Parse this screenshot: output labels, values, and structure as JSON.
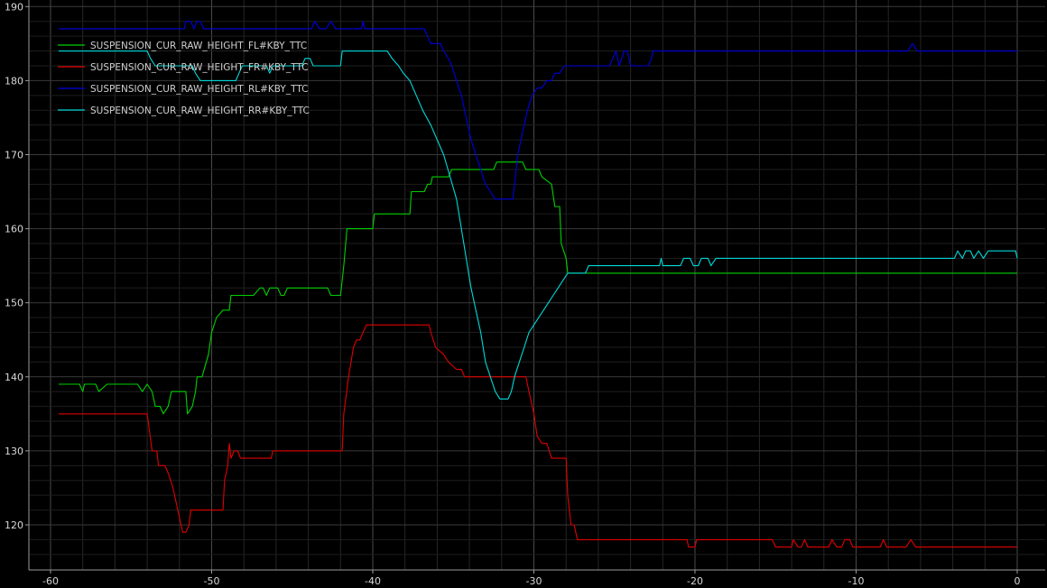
{
  "chart_data": {
    "type": "line",
    "title": "",
    "xlabel": "",
    "ylabel": "",
    "xlim": [
      -60,
      0
    ],
    "ylim": [
      115,
      190
    ],
    "x_ticks": [
      -60,
      -50,
      -40,
      -30,
      -20,
      -10,
      0
    ],
    "y_ticks": [
      120,
      130,
      140,
      150,
      160,
      170,
      180,
      190
    ],
    "grid": true,
    "legend_position": "top-left",
    "series": [
      {
        "name": "SUSPENSION_CUR_RAW_HEIGHT_FL#KBY_TTC",
        "color": "#00d000",
        "points": [
          [
            -59.5,
            139
          ],
          [
            -58.2,
            139
          ],
          [
            -58.0,
            138
          ],
          [
            -57.9,
            139
          ],
          [
            -57.2,
            139
          ],
          [
            -57.0,
            138
          ],
          [
            -56.5,
            139
          ],
          [
            -54.6,
            139
          ],
          [
            -54.3,
            138
          ],
          [
            -54.0,
            139
          ],
          [
            -53.7,
            138
          ],
          [
            -53.5,
            136
          ],
          [
            -53.2,
            136
          ],
          [
            -53.0,
            135
          ],
          [
            -52.7,
            136
          ],
          [
            -52.5,
            138
          ],
          [
            -51.6,
            138
          ],
          [
            -51.5,
            135
          ],
          [
            -51.2,
            136
          ],
          [
            -51.0,
            138
          ],
          [
            -50.9,
            140
          ],
          [
            -50.6,
            140
          ],
          [
            -50.2,
            143
          ],
          [
            -50.0,
            146
          ],
          [
            -49.7,
            148
          ],
          [
            -49.3,
            149
          ],
          [
            -48.9,
            149
          ],
          [
            -48.8,
            151
          ],
          [
            -47.4,
            151
          ],
          [
            -47.0,
            152
          ],
          [
            -46.8,
            152
          ],
          [
            -46.6,
            151
          ],
          [
            -46.4,
            152
          ],
          [
            -45.9,
            152
          ],
          [
            -45.7,
            151
          ],
          [
            -45.5,
            151
          ],
          [
            -45.3,
            152
          ],
          [
            -42.8,
            152
          ],
          [
            -42.6,
            151
          ],
          [
            -42.0,
            151
          ],
          [
            -41.8,
            155
          ],
          [
            -41.6,
            160
          ],
          [
            -40.0,
            160
          ],
          [
            -39.9,
            162
          ],
          [
            -37.7,
            162
          ],
          [
            -37.6,
            165
          ],
          [
            -36.8,
            165
          ],
          [
            -36.6,
            166
          ],
          [
            -36.4,
            166
          ],
          [
            -36.3,
            167
          ],
          [
            -35.3,
            167
          ],
          [
            -35.1,
            168
          ],
          [
            -34.3,
            168
          ],
          [
            -34.1,
            168
          ],
          [
            -32.5,
            168
          ],
          [
            -32.3,
            169
          ],
          [
            -30.7,
            169
          ],
          [
            -30.5,
            168
          ],
          [
            -29.7,
            168
          ],
          [
            -29.5,
            167
          ],
          [
            -28.9,
            166
          ],
          [
            -28.7,
            163
          ],
          [
            -28.4,
            163
          ],
          [
            -28.3,
            158
          ],
          [
            -28.0,
            156
          ],
          [
            -27.9,
            154
          ],
          [
            0,
            154
          ]
        ]
      },
      {
        "name": "SUSPENSION_CUR_RAW_HEIGHT_FR#KBY_TTC",
        "color": "#e00000",
        "points": [
          [
            -59.5,
            135
          ],
          [
            -54.0,
            135
          ],
          [
            -53.7,
            130
          ],
          [
            -53.4,
            130
          ],
          [
            -53.3,
            128
          ],
          [
            -52.9,
            128
          ],
          [
            -52.7,
            127
          ],
          [
            -52.4,
            125
          ],
          [
            -52.1,
            122
          ],
          [
            -51.8,
            119
          ],
          [
            -51.6,
            119
          ],
          [
            -51.4,
            120
          ],
          [
            -51.3,
            122
          ],
          [
            -49.3,
            122
          ],
          [
            -49.2,
            126
          ],
          [
            -49.0,
            128
          ],
          [
            -48.9,
            131
          ],
          [
            -48.8,
            129
          ],
          [
            -48.6,
            130
          ],
          [
            -48.4,
            130
          ],
          [
            -48.2,
            129
          ],
          [
            -46.3,
            129
          ],
          [
            -46.2,
            130
          ],
          [
            -41.9,
            130
          ],
          [
            -41.8,
            135
          ],
          [
            -41.5,
            140
          ],
          [
            -41.2,
            144
          ],
          [
            -41.0,
            145
          ],
          [
            -40.8,
            145
          ],
          [
            -40.6,
            146
          ],
          [
            -40.4,
            147
          ],
          [
            -36.5,
            147
          ],
          [
            -36.4,
            146
          ],
          [
            -36.1,
            144
          ],
          [
            -35.6,
            143
          ],
          [
            -35.3,
            142
          ],
          [
            -34.8,
            141
          ],
          [
            -34.5,
            141
          ],
          [
            -34.3,
            140
          ],
          [
            -30.5,
            140
          ],
          [
            -30.3,
            138
          ],
          [
            -30.0,
            135
          ],
          [
            -29.8,
            132
          ],
          [
            -29.5,
            131
          ],
          [
            -29.2,
            131
          ],
          [
            -28.9,
            129
          ],
          [
            -28.0,
            129
          ],
          [
            -27.9,
            124
          ],
          [
            -27.7,
            120
          ],
          [
            -27.5,
            120
          ],
          [
            -27.3,
            118
          ],
          [
            -20.5,
            118
          ],
          [
            -20.4,
            117
          ],
          [
            -20.0,
            117
          ],
          [
            -19.9,
            118
          ],
          [
            -15.2,
            118
          ],
          [
            -15.0,
            117
          ],
          [
            -14.0,
            117
          ],
          [
            -13.9,
            118
          ],
          [
            -13.6,
            117
          ],
          [
            -13.4,
            117
          ],
          [
            -13.2,
            118
          ],
          [
            -13.0,
            117
          ],
          [
            -11.7,
            117
          ],
          [
            -11.5,
            118
          ],
          [
            -11.2,
            117
          ],
          [
            -10.9,
            117
          ],
          [
            -10.7,
            118
          ],
          [
            -10.4,
            118
          ],
          [
            -10.2,
            117
          ],
          [
            -8.5,
            117
          ],
          [
            -8.3,
            118
          ],
          [
            -8.1,
            117
          ],
          [
            -6.9,
            117
          ],
          [
            -6.6,
            118
          ],
          [
            -6.3,
            117
          ],
          [
            0,
            117
          ]
        ]
      },
      {
        "name": "SUSPENSION_CUR_RAW_HEIGHT_RL#KBY_TTC",
        "color": "#0000e0",
        "points": [
          [
            -59.5,
            187
          ],
          [
            -51.7,
            187
          ],
          [
            -51.6,
            188
          ],
          [
            -51.3,
            188
          ],
          [
            -51.1,
            187
          ],
          [
            -50.9,
            188
          ],
          [
            -50.7,
            188
          ],
          [
            -50.5,
            187
          ],
          [
            -43.8,
            187
          ],
          [
            -43.6,
            188
          ],
          [
            -43.3,
            187
          ],
          [
            -42.9,
            187
          ],
          [
            -42.6,
            188
          ],
          [
            -42.3,
            187
          ],
          [
            -40.7,
            187
          ],
          [
            -40.6,
            188
          ],
          [
            -40.5,
            187
          ],
          [
            -36.8,
            187
          ],
          [
            -36.6,
            186
          ],
          [
            -36.4,
            185
          ],
          [
            -35.8,
            185
          ],
          [
            -35.6,
            184
          ],
          [
            -35.3,
            183
          ],
          [
            -35.1,
            182
          ],
          [
            -34.8,
            180
          ],
          [
            -34.5,
            178
          ],
          [
            -34.2,
            175
          ],
          [
            -33.9,
            172
          ],
          [
            -33.6,
            170
          ],
          [
            -33.3,
            168
          ],
          [
            -33.0,
            166
          ],
          [
            -32.7,
            165
          ],
          [
            -32.4,
            164
          ],
          [
            -31.3,
            164
          ],
          [
            -31.2,
            166
          ],
          [
            -31.0,
            170
          ],
          [
            -30.7,
            173
          ],
          [
            -30.4,
            176
          ],
          [
            -30.1,
            178
          ],
          [
            -29.8,
            179
          ],
          [
            -29.5,
            179
          ],
          [
            -29.2,
            180
          ],
          [
            -28.9,
            180
          ],
          [
            -28.7,
            181
          ],
          [
            -28.4,
            181
          ],
          [
            -28.1,
            182
          ],
          [
            -25.3,
            182
          ],
          [
            -25.1,
            183
          ],
          [
            -24.9,
            184
          ],
          [
            -24.7,
            182
          ],
          [
            -24.4,
            184
          ],
          [
            -24.2,
            184
          ],
          [
            -24.0,
            182
          ],
          [
            -22.9,
            182
          ],
          [
            -22.7,
            183
          ],
          [
            -22.6,
            184
          ],
          [
            -6.8,
            184
          ],
          [
            -6.5,
            185
          ],
          [
            -6.2,
            184
          ],
          [
            0,
            184
          ]
        ]
      },
      {
        "name": "SUSPENSION_CUR_RAW_HEIGHT_RR#KBY_TTC",
        "color": "#00d8d8",
        "points": [
          [
            -59.5,
            184
          ],
          [
            -54.0,
            184
          ],
          [
            -53.8,
            183
          ],
          [
            -53.5,
            182
          ],
          [
            -51.2,
            182
          ],
          [
            -51.0,
            181
          ],
          [
            -50.7,
            180
          ],
          [
            -48.5,
            180
          ],
          [
            -48.3,
            181
          ],
          [
            -48.1,
            182
          ],
          [
            -46.6,
            182
          ],
          [
            -46.4,
            181
          ],
          [
            -46.2,
            182
          ],
          [
            -44.4,
            182
          ],
          [
            -44.2,
            183
          ],
          [
            -43.9,
            183
          ],
          [
            -43.7,
            182
          ],
          [
            -42.0,
            182
          ],
          [
            -41.9,
            184
          ],
          [
            -39.1,
            184
          ],
          [
            -38.8,
            183
          ],
          [
            -38.4,
            182
          ],
          [
            -38.1,
            181
          ],
          [
            -37.7,
            180
          ],
          [
            -37.3,
            178
          ],
          [
            -36.9,
            176
          ],
          [
            -36.4,
            174
          ],
          [
            -36.0,
            172
          ],
          [
            -35.6,
            170
          ],
          [
            -35.2,
            167
          ],
          [
            -34.8,
            164
          ],
          [
            -34.5,
            160
          ],
          [
            -34.2,
            156
          ],
          [
            -33.9,
            152
          ],
          [
            -33.6,
            149
          ],
          [
            -33.3,
            146
          ],
          [
            -33.0,
            142
          ],
          [
            -32.7,
            140
          ],
          [
            -32.4,
            138
          ],
          [
            -32.1,
            137
          ],
          [
            -31.6,
            137
          ],
          [
            -31.4,
            138
          ],
          [
            -31.2,
            140
          ],
          [
            -30.9,
            142
          ],
          [
            -30.6,
            144
          ],
          [
            -30.3,
            146
          ],
          [
            -30.0,
            147
          ],
          [
            -29.7,
            148
          ],
          [
            -29.4,
            149
          ],
          [
            -29.1,
            150
          ],
          [
            -28.8,
            151
          ],
          [
            -28.5,
            152
          ],
          [
            -28.2,
            153
          ],
          [
            -27.9,
            154
          ],
          [
            -26.8,
            154
          ],
          [
            -26.6,
            155
          ],
          [
            -22.2,
            155
          ],
          [
            -22.1,
            156
          ],
          [
            -22.0,
            155
          ],
          [
            -20.9,
            155
          ],
          [
            -20.7,
            156
          ],
          [
            -20.3,
            156
          ],
          [
            -20.1,
            155
          ],
          [
            -19.8,
            155
          ],
          [
            -19.6,
            156
          ],
          [
            -19.2,
            156
          ],
          [
            -19.0,
            155
          ],
          [
            -18.7,
            156
          ],
          [
            -3.9,
            156
          ],
          [
            -3.7,
            157
          ],
          [
            -3.4,
            156
          ],
          [
            -3.2,
            157
          ],
          [
            -2.9,
            157
          ],
          [
            -2.7,
            156
          ],
          [
            -2.4,
            157
          ],
          [
            -2.1,
            156
          ],
          [
            -1.8,
            157
          ],
          [
            -0.1,
            157
          ],
          [
            0,
            156
          ]
        ]
      }
    ]
  }
}
